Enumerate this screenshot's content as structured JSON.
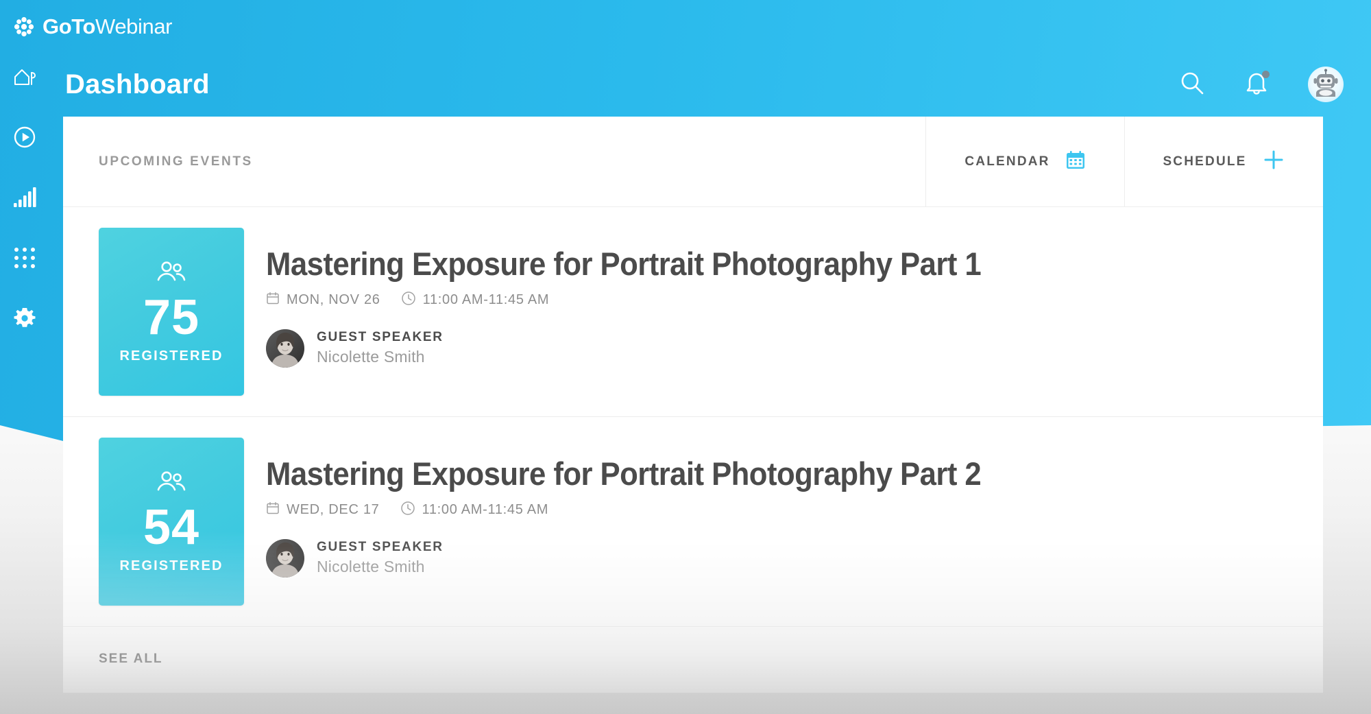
{
  "brand": {
    "logo_icon": "gotowebinar-asterisk-icon",
    "name_strong": "GoTo",
    "name_light": "Webinar"
  },
  "sidebar": {
    "items": [
      {
        "icon": "home-icon",
        "name": "home"
      },
      {
        "icon": "play-circle-icon",
        "name": "recordings"
      },
      {
        "icon": "bar-chart-icon",
        "name": "analytics"
      },
      {
        "icon": "grid-apps-icon",
        "name": "apps"
      },
      {
        "icon": "gear-icon",
        "name": "settings"
      }
    ]
  },
  "header": {
    "title": "Dashboard",
    "actions": [
      {
        "icon": "search-icon",
        "name": "search"
      },
      {
        "icon": "bell-icon",
        "name": "notifications",
        "has_badge": true
      },
      {
        "icon": "robot-avatar-icon",
        "name": "account"
      }
    ]
  },
  "card": {
    "section_label": "UPCOMING EVENTS",
    "calendar_button": {
      "label": "CALENDAR",
      "icon": "calendar-icon",
      "icon_color": "#3dc6f0"
    },
    "schedule_button": {
      "label": "SCHEDULE",
      "icon": "plus-icon",
      "icon_color": "#3dc6f0"
    },
    "see_all_label": "SEE ALL",
    "events": [
      {
        "registered_count": "75",
        "registered_label": "REGISTERED",
        "title": "Mastering Exposure for Portrait Photography Part 1",
        "date": "MON, NOV 26",
        "time": "11:00 AM-11:45 AM",
        "speaker_role": "GUEST SPEAKER",
        "speaker_name": "Nicolette Smith"
      },
      {
        "registered_count": "54",
        "registered_label": "REGISTERED",
        "title": "Mastering Exposure for Portrait Photography Part 2",
        "date": "WED, DEC 17",
        "time": "11:00 AM-11:45 AM",
        "speaker_role": "GUEST SPEAKER",
        "speaker_name": "Nicolette Smith"
      }
    ]
  },
  "colors": {
    "brand_blue": "#2bbaec",
    "brand_blue_dark": "#22aee3",
    "accent_teal": "#43cbdf",
    "accent_cyan": "#3dc6f0",
    "text_dark": "#4b4b4b",
    "text_muted": "#9a9a9a"
  }
}
